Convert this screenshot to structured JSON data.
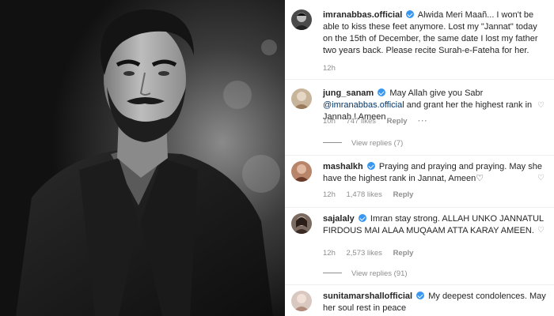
{
  "post": {
    "author": "imranabbas.official",
    "caption": "Alwida Meri Maañ... I won't be able to kiss these feet anymore. Lost my \"Jannat\" today on the 15th of December, the same date I lost my father two years back. Please recite Surah-e-Fateha for her.",
    "time": "12h"
  },
  "comments": [
    {
      "username": "jung_sanam",
      "text_before": "May Allah give you Sabr ",
      "mention": "@imranabbas.official",
      "text_after": " and grant her the highest rank in Jannah ! Ameen",
      "time": "10h",
      "likes": "747 likes",
      "reply_label": "Reply",
      "view_replies": "View replies (7)",
      "avatar_color": "#c8b49a"
    },
    {
      "username": "mashalkh",
      "text": "Praying and praying and praying. May she have the highest rank in Jannat, Ameen♡",
      "time": "12h",
      "likes": "1,478 likes",
      "reply_label": "Reply",
      "avatar_color": "#b8846a"
    },
    {
      "username": "sajalaly",
      "text": "Imran stay strong. ALLAH UNKO JANNATUL FIRDOUS MAI ALAA MUQAAM ATTA KARAY AMEEN.",
      "time": "12h",
      "likes": "2,573 likes",
      "reply_label": "Reply",
      "view_replies": "View replies (91)",
      "avatar_color": "#7a6a60"
    },
    {
      "username": "sunitamarshallofficial",
      "text": "My deepest condolences. May her soul rest in peace",
      "avatar_color": "#d8c8c0"
    }
  ],
  "icons": {
    "verified": "verified-badge-icon",
    "like": "heart-icon",
    "more": "more-options-icon"
  },
  "colors": {
    "verified": "#3897f0",
    "mention": "#00376b",
    "meta": "#8e8e8e"
  }
}
